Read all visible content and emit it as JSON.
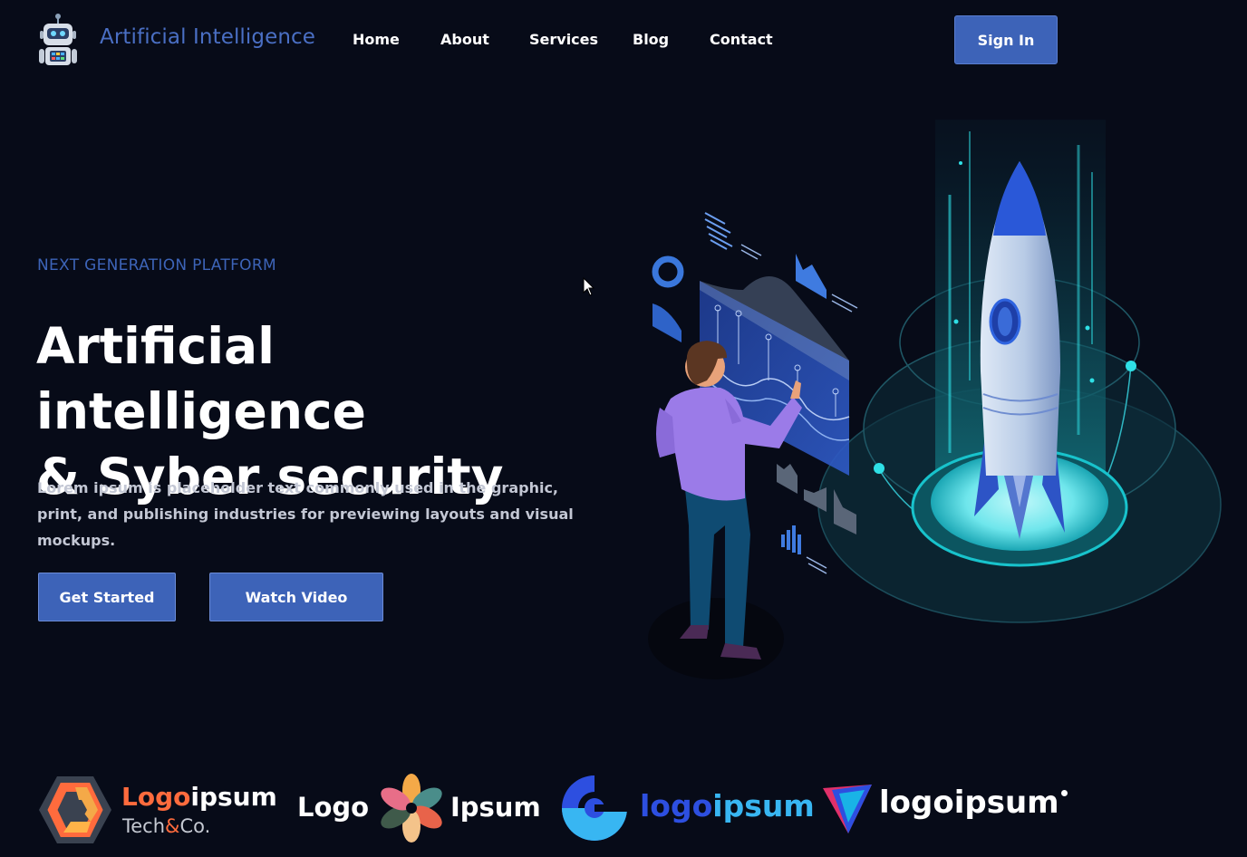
{
  "nav": {
    "brand": "Artificial Intelligence",
    "links": [
      "Home",
      "About",
      "Services",
      "Blog",
      "Contact"
    ],
    "signin": "Sign In"
  },
  "hero": {
    "kicker": "NEXT GENERATION PLATFORM",
    "title_line1": "Artificial intelligence",
    "title_line2": "& Syber security",
    "description": "Lorem ipsum is placeholder text commonly used in the graphic, print, and publishing industries for previewing layouts and visual mockups.",
    "primary_button": "Get Started",
    "secondary_button": "Watch Video"
  },
  "partners": {
    "logo1": {
      "word1": "Logo",
      "word2": "ipsum",
      "sub1": "Tech",
      "amp": "&",
      "sub2": "Co."
    },
    "logo2": {
      "word1": "Logo",
      "word2": "Ipsum"
    },
    "logo3": {
      "word1": "logo",
      "word2": "ipsum"
    },
    "logo4": {
      "text": "logoipsum"
    }
  },
  "colors": {
    "background": "#070b18",
    "accent": "#3d63b8",
    "brand_text": "#4a6fc4",
    "glow": "#2fe0e6"
  },
  "icons": {
    "brand": "robot-icon",
    "cursor": "mouse-pointer-icon"
  }
}
